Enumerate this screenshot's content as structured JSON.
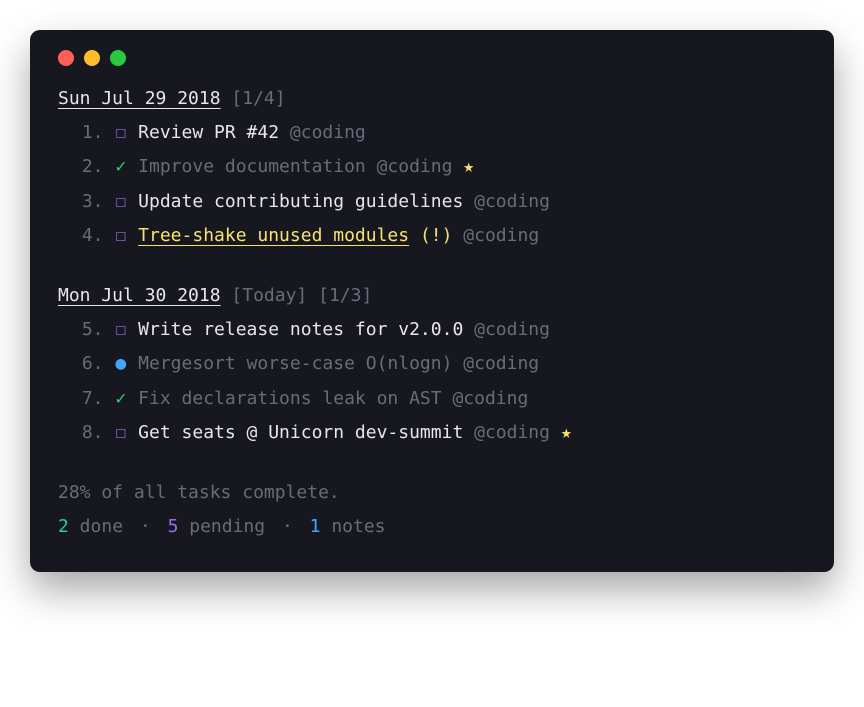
{
  "sections": [
    {
      "date": "Sun Jul 29 2018",
      "meta": "[1/4]",
      "today": false,
      "tasks": [
        {
          "n": "1",
          "state": "box",
          "segments": [
            [
              "white",
              "Review PR #42 "
            ],
            [
              "dim",
              "@coding"
            ]
          ]
        },
        {
          "n": "2",
          "state": "check",
          "segments": [
            [
              "dim",
              "Improve documentation @coding "
            ],
            [
              "star",
              "★"
            ]
          ]
        },
        {
          "n": "3",
          "state": "box",
          "segments": [
            [
              "white",
              "Update contributing guidelines "
            ],
            [
              "dim",
              "@coding"
            ]
          ]
        },
        {
          "n": "4",
          "state": "box",
          "segments": [
            [
              "yellowU",
              "Tree-shake unused modules"
            ],
            [
              "yellow",
              " (!) "
            ],
            [
              "dim",
              "@coding"
            ]
          ]
        }
      ]
    },
    {
      "date": "Mon Jul 30 2018",
      "meta": "[1/3]",
      "today": true,
      "tasks": [
        {
          "n": "5",
          "state": "box",
          "segments": [
            [
              "white",
              "Write release notes for v2.0.0 "
            ],
            [
              "dim",
              "@coding"
            ]
          ]
        },
        {
          "n": "6",
          "state": "bullet",
          "segments": [
            [
              "dim",
              "Mergesort worse-case O(nlogn) @coding"
            ]
          ]
        },
        {
          "n": "7",
          "state": "check",
          "segments": [
            [
              "dim",
              "Fix declarations leak on AST @coding"
            ]
          ]
        },
        {
          "n": "8",
          "state": "box",
          "segments": [
            [
              "white",
              "Get seats @ Unicorn dev-summit "
            ],
            [
              "dim",
              "@coding "
            ],
            [
              "star",
              "★"
            ]
          ]
        }
      ]
    }
  ],
  "footer": {
    "percent_line": "28% of all tasks complete.",
    "done_n": "2",
    "done_l": " done ",
    "pending_n": "5",
    "pending_l": " pending ",
    "notes_n": "1",
    "notes_l": " notes",
    "sep": "·"
  },
  "today_label": "[Today]",
  "glyphs": {
    "box": "☐",
    "check": "✓",
    "bullet": "●"
  }
}
